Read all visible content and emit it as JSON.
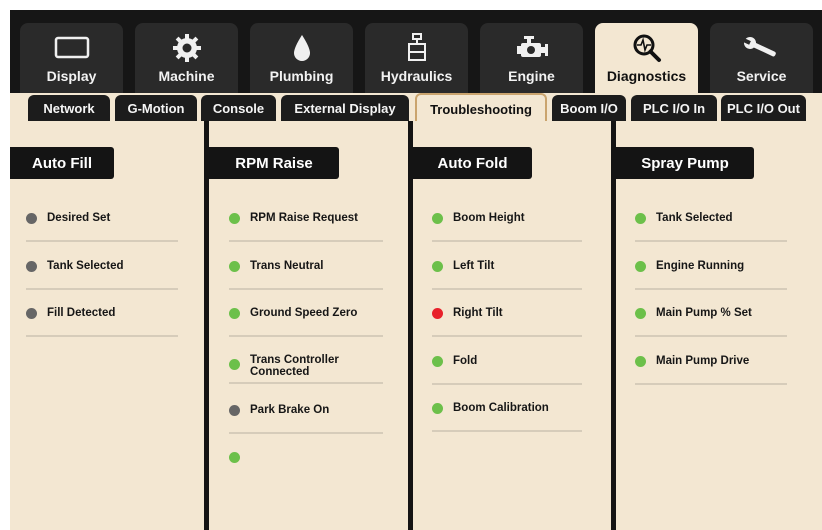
{
  "main_tabs": [
    {
      "label": "Display",
      "icon": "display-icon",
      "active": false
    },
    {
      "label": "Machine",
      "icon": "gear-icon",
      "active": false
    },
    {
      "label": "Plumbing",
      "icon": "droplet-icon",
      "active": false
    },
    {
      "label": "Hydraulics",
      "icon": "hydraulic-cylinder-icon",
      "active": false
    },
    {
      "label": "Engine",
      "icon": "engine-icon",
      "active": false
    },
    {
      "label": "Diagnostics",
      "icon": "diagnostics-magnifier-icon",
      "active": true
    },
    {
      "label": "Service",
      "icon": "wrench-icon",
      "active": false
    }
  ],
  "sub_tabs": [
    {
      "label": "Network",
      "active": false
    },
    {
      "label": "G-Motion",
      "active": false
    },
    {
      "label": "Console",
      "active": false
    },
    {
      "label": "External Display",
      "active": false
    },
    {
      "label": "Troubleshooting",
      "active": true
    },
    {
      "label": "Boom I/O",
      "active": false
    },
    {
      "label": "PLC I/O In",
      "active": false
    },
    {
      "label": "PLC I/O Out",
      "active": false
    }
  ],
  "columns": [
    {
      "title": "Auto Fill",
      "items": [
        {
          "label": "Desired Set",
          "status": "gray"
        },
        {
          "label": "Tank Selected",
          "status": "gray"
        },
        {
          "label": "Fill Detected",
          "status": "gray"
        }
      ]
    },
    {
      "title": "RPM Raise",
      "items": [
        {
          "label": "RPM Raise Request",
          "status": "green"
        },
        {
          "label": "Trans Neutral",
          "status": "green"
        },
        {
          "label": "Ground Speed Zero",
          "status": "green"
        },
        {
          "label": "Trans Controller",
          "label2": "Connected",
          "status": "green"
        },
        {
          "label": "Park Brake On",
          "status": "gray"
        },
        {
          "label": "",
          "status": "green"
        }
      ]
    },
    {
      "title": "Auto Fold",
      "items": [
        {
          "label": "Boom Height",
          "status": "green"
        },
        {
          "label": "Left Tilt",
          "status": "green"
        },
        {
          "label": "Right Tilt",
          "status": "red"
        },
        {
          "label": "Fold",
          "status": "green"
        },
        {
          "label": "Boom Calibration",
          "status": "green"
        }
      ]
    },
    {
      "title": "Spray Pump",
      "items": [
        {
          "label": "Tank Selected",
          "status": "green"
        },
        {
          "label": "Engine Running",
          "status": "green"
        },
        {
          "label": "Main Pump % Set",
          "status": "green"
        },
        {
          "label": "Main Pump Drive",
          "status": "green"
        }
      ]
    }
  ],
  "status_colors": {
    "green": "#6cc04a",
    "gray": "#666666",
    "red": "#e8202a"
  }
}
